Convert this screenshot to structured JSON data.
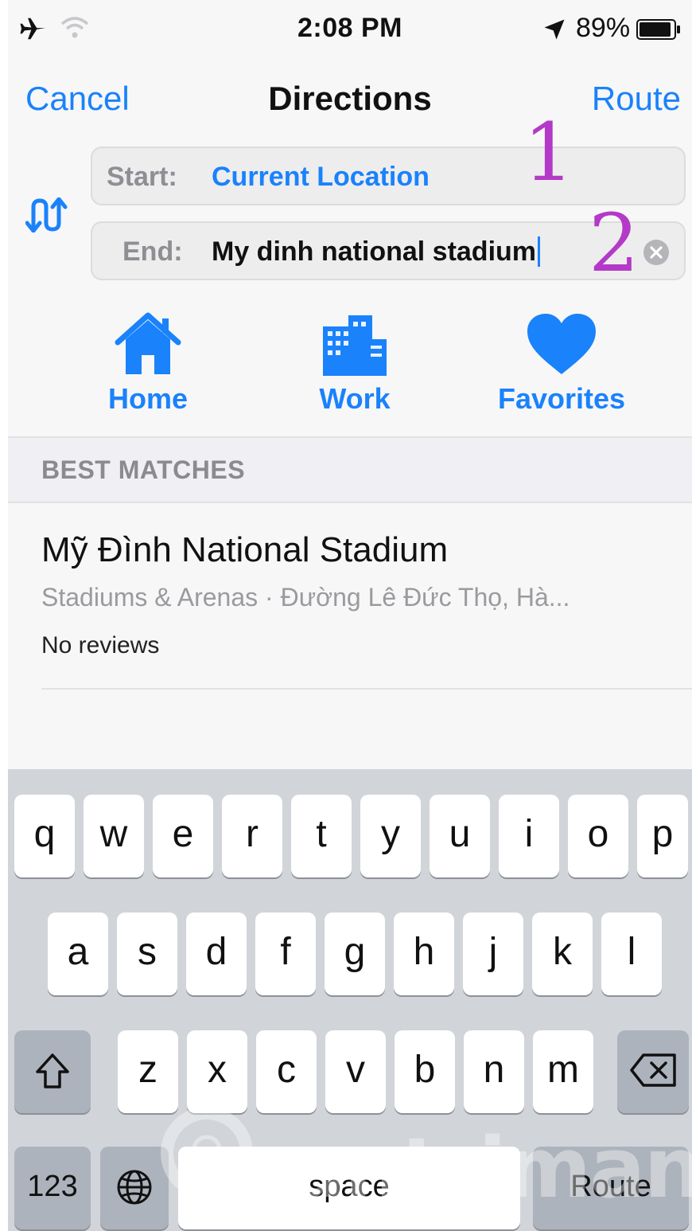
{
  "status_bar": {
    "time": "2:08 PM",
    "battery_percent": "89%",
    "icons": [
      "airplane-icon",
      "wifi-icon",
      "location-arrow-icon",
      "battery-icon"
    ]
  },
  "nav": {
    "cancel_label": "Cancel",
    "title": "Directions",
    "route_label": "Route"
  },
  "route_fields": {
    "start_label": "Start:",
    "start_value": "Current Location",
    "end_label": "End:",
    "end_value": "My dinh national stadium"
  },
  "annotations": {
    "one": "1",
    "two": "2"
  },
  "shortcuts": [
    {
      "label": "Home",
      "icon": "house-icon"
    },
    {
      "label": "Work",
      "icon": "building-icon"
    },
    {
      "label": "Favorites",
      "icon": "heart-icon"
    }
  ],
  "results": {
    "section_title": "BEST MATCHES",
    "items": [
      {
        "title": "Mỹ Đình National Stadium",
        "subtitle": "Stadiums & Arenas · Đường Lê Đức Thọ, Hà...",
        "reviews": "No reviews"
      }
    ]
  },
  "keyboard": {
    "row1": [
      "q",
      "w",
      "e",
      "r",
      "t",
      "y",
      "u",
      "i",
      "o",
      "p"
    ],
    "row2": [
      "a",
      "s",
      "d",
      "f",
      "g",
      "h",
      "j",
      "k",
      "l"
    ],
    "row3": [
      "z",
      "x",
      "c",
      "v",
      "b",
      "n",
      "m"
    ],
    "numbers_label": "123",
    "space_label": "space",
    "return_label": "Route"
  },
  "colors": {
    "accent": "#1a82fb",
    "annotation": "#b439c8",
    "keyboard_bg": "#d1d4d9"
  },
  "watermark": {
    "text": "uantrimang"
  }
}
